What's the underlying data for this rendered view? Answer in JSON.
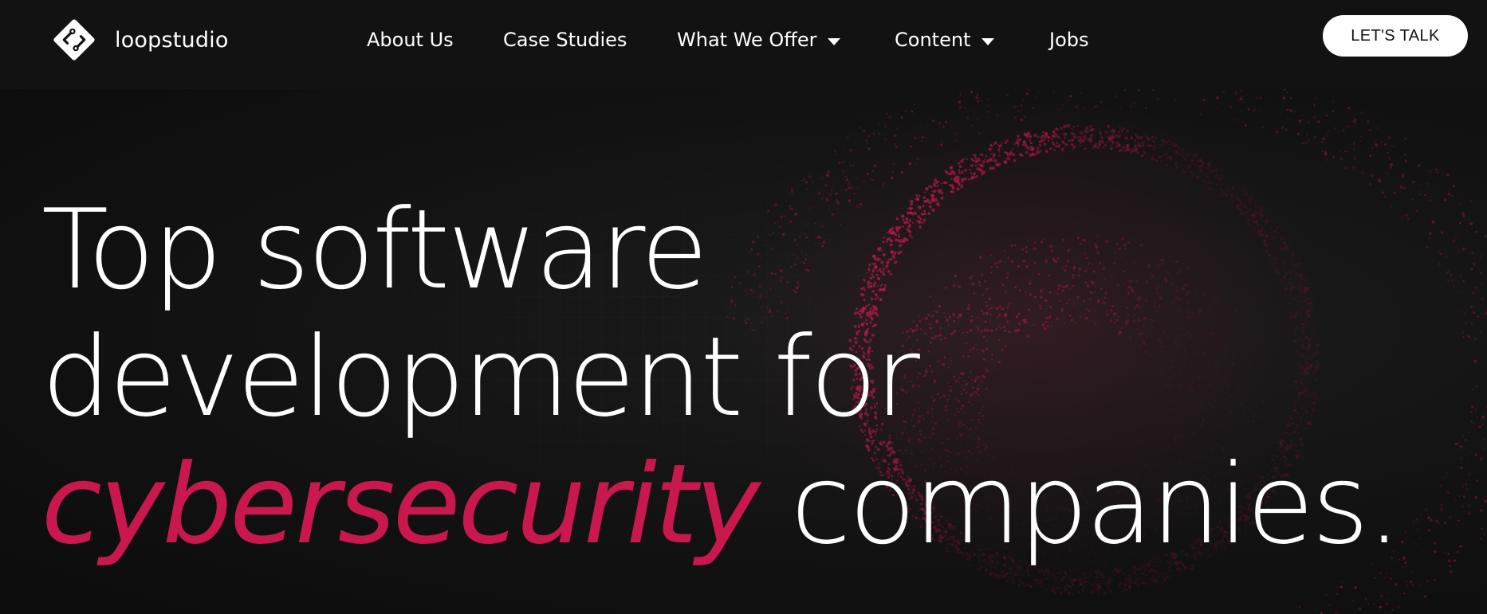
{
  "brand": {
    "name": "loopstudio",
    "logo_icon": "loopstudio-logo-icon"
  },
  "nav": {
    "items": [
      {
        "label": "About Us",
        "has_dropdown": false
      },
      {
        "label": "Case Studies",
        "has_dropdown": false
      },
      {
        "label": "What We Offer",
        "has_dropdown": true
      },
      {
        "label": "Content",
        "has_dropdown": true
      },
      {
        "label": "Jobs",
        "has_dropdown": false
      }
    ]
  },
  "cta": {
    "label": "LET'S TALK"
  },
  "hero": {
    "line1": "Top software",
    "line2": "development for",
    "accent_word": "cybersecurity",
    "line3_rest": " companies.",
    "decor": "particle-sphere-graphic"
  },
  "colors": {
    "background": "#111111",
    "header": "#121212",
    "text": "#ffffff",
    "accent": "#c8184e",
    "cta_bg": "#ffffff",
    "cta_text": "#111111"
  }
}
